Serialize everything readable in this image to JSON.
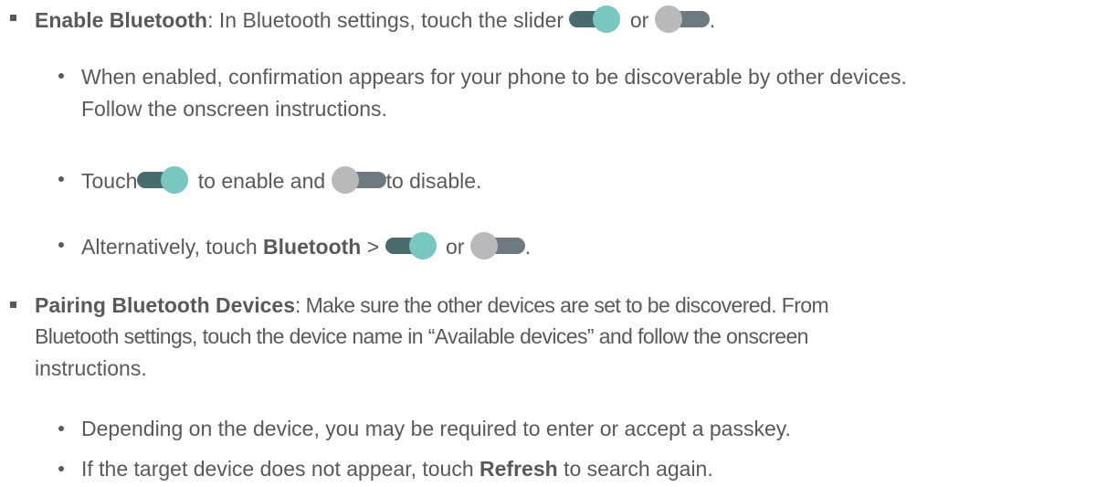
{
  "items": [
    {
      "title": "Enable Bluetooth",
      "text_before": ": In Bluetooth settings, touch the slider ",
      "or_word": "or",
      "end_period": ".",
      "subitems": [
        {
          "line1": "When enabled, confirmation appears for your phone to be discoverable by other devices.",
          "line2": "Follow the onscreen instructions."
        },
        {
          "touch_word": "Touch",
          "enable_text": "to enable and",
          "disable_text": "to disable."
        },
        {
          "prefix": "Alternatively, touch ",
          "bold": "Bluetooth",
          "arrow": ">",
          "or_word": "or",
          "end_period": "."
        }
      ]
    },
    {
      "title": "Pairing Bluetooth Devices",
      "line1_rest": ": Make sure the other devices are set to be discovered. From",
      "line2": "Bluetooth settings, touch the device name in “Available devices” and follow the onscreen",
      "line3": "instructions.",
      "subitems": [
        {
          "text": "Depending on the device, you may be required to enter or accept a passkey."
        },
        {
          "prefix": "If the target device does not appear, touch ",
          "bold": "Refresh",
          "suffix": " to search again."
        }
      ]
    }
  ],
  "toggle_icons": {
    "on": "toggle-on-icon",
    "off": "toggle-off-icon",
    "colors": {
      "on_track": "#4a6b6e",
      "on_knob": "#79c7c0",
      "off_track": "#6f7a80",
      "off_knob": "#b8b9bb"
    }
  },
  "text_color": "#58595b"
}
